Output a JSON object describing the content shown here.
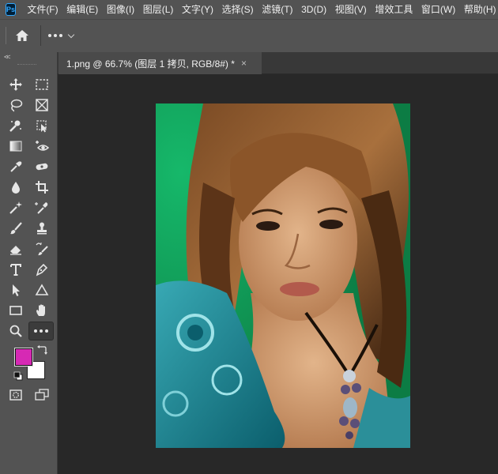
{
  "app": {
    "logo_text": "Ps",
    "menu": [
      "文件(F)",
      "编辑(E)",
      "图像(I)",
      "图层(L)",
      "文字(Y)",
      "选择(S)",
      "滤镜(T)",
      "3D(D)",
      "视图(V)",
      "增效工具",
      "窗口(W)",
      "帮助(H)"
    ]
  },
  "optionsbar": {
    "home_icon": "home-icon",
    "more_icon": "more-options-icon"
  },
  "toolbar": {
    "collapse_label": "<<",
    "tools": [
      {
        "name": "move-tool",
        "icon": "move-icon"
      },
      {
        "name": "artboard-marquee-tool",
        "icon": "rect-marquee-icon"
      },
      {
        "name": "lasso-tool",
        "icon": "lasso-icon"
      },
      {
        "name": "frame-tool",
        "icon": "frame-icon"
      },
      {
        "name": "quick-selection-tool",
        "icon": "quick-select-icon"
      },
      {
        "name": "object-selection-tool",
        "icon": "object-select-icon"
      },
      {
        "name": "gradient-tool",
        "icon": "gradient-icon"
      },
      {
        "name": "red-eye-tool",
        "icon": "red-eye-icon"
      },
      {
        "name": "eyedropper-tool",
        "icon": "eyedropper-icon"
      },
      {
        "name": "healing-brush-tool",
        "icon": "bandage-icon"
      },
      {
        "name": "blur-tool",
        "icon": "drop-icon"
      },
      {
        "name": "crop-tool",
        "icon": "crop-icon"
      },
      {
        "name": "magic-wand-tool",
        "icon": "magic-wand-icon"
      },
      {
        "name": "color-sampler-tool",
        "icon": "color-sampler-icon"
      },
      {
        "name": "brush-tool",
        "icon": "brush-icon"
      },
      {
        "name": "clone-stamp-tool",
        "icon": "stamp-icon"
      },
      {
        "name": "eraser-tool",
        "icon": "eraser-icon"
      },
      {
        "name": "history-brush-tool",
        "icon": "history-brush-icon"
      },
      {
        "name": "type-tool",
        "icon": "type-icon"
      },
      {
        "name": "pen-tool",
        "icon": "pen-icon"
      },
      {
        "name": "path-selection-tool",
        "icon": "arrow-icon"
      },
      {
        "name": "shape-triangle-tool",
        "icon": "triangle-icon"
      },
      {
        "name": "rectangle-tool",
        "icon": "rectangle-icon"
      },
      {
        "name": "hand-tool",
        "icon": "hand-icon"
      },
      {
        "name": "zoom-tool",
        "icon": "zoom-icon"
      },
      {
        "name": "edit-toolbar",
        "icon": "more-icon"
      }
    ],
    "foreground_color": "#d629b4",
    "background_color": "#ffffff",
    "quick_mask_icon": "quick-mask-icon",
    "screen_mode_icon": "screen-mode-icon"
  },
  "document": {
    "tab_label": "1.png @ 66.7% (图层 1 拷贝, RGB/8#) *",
    "close_label": "×",
    "image_alt_semantic": "portrait-photo"
  }
}
